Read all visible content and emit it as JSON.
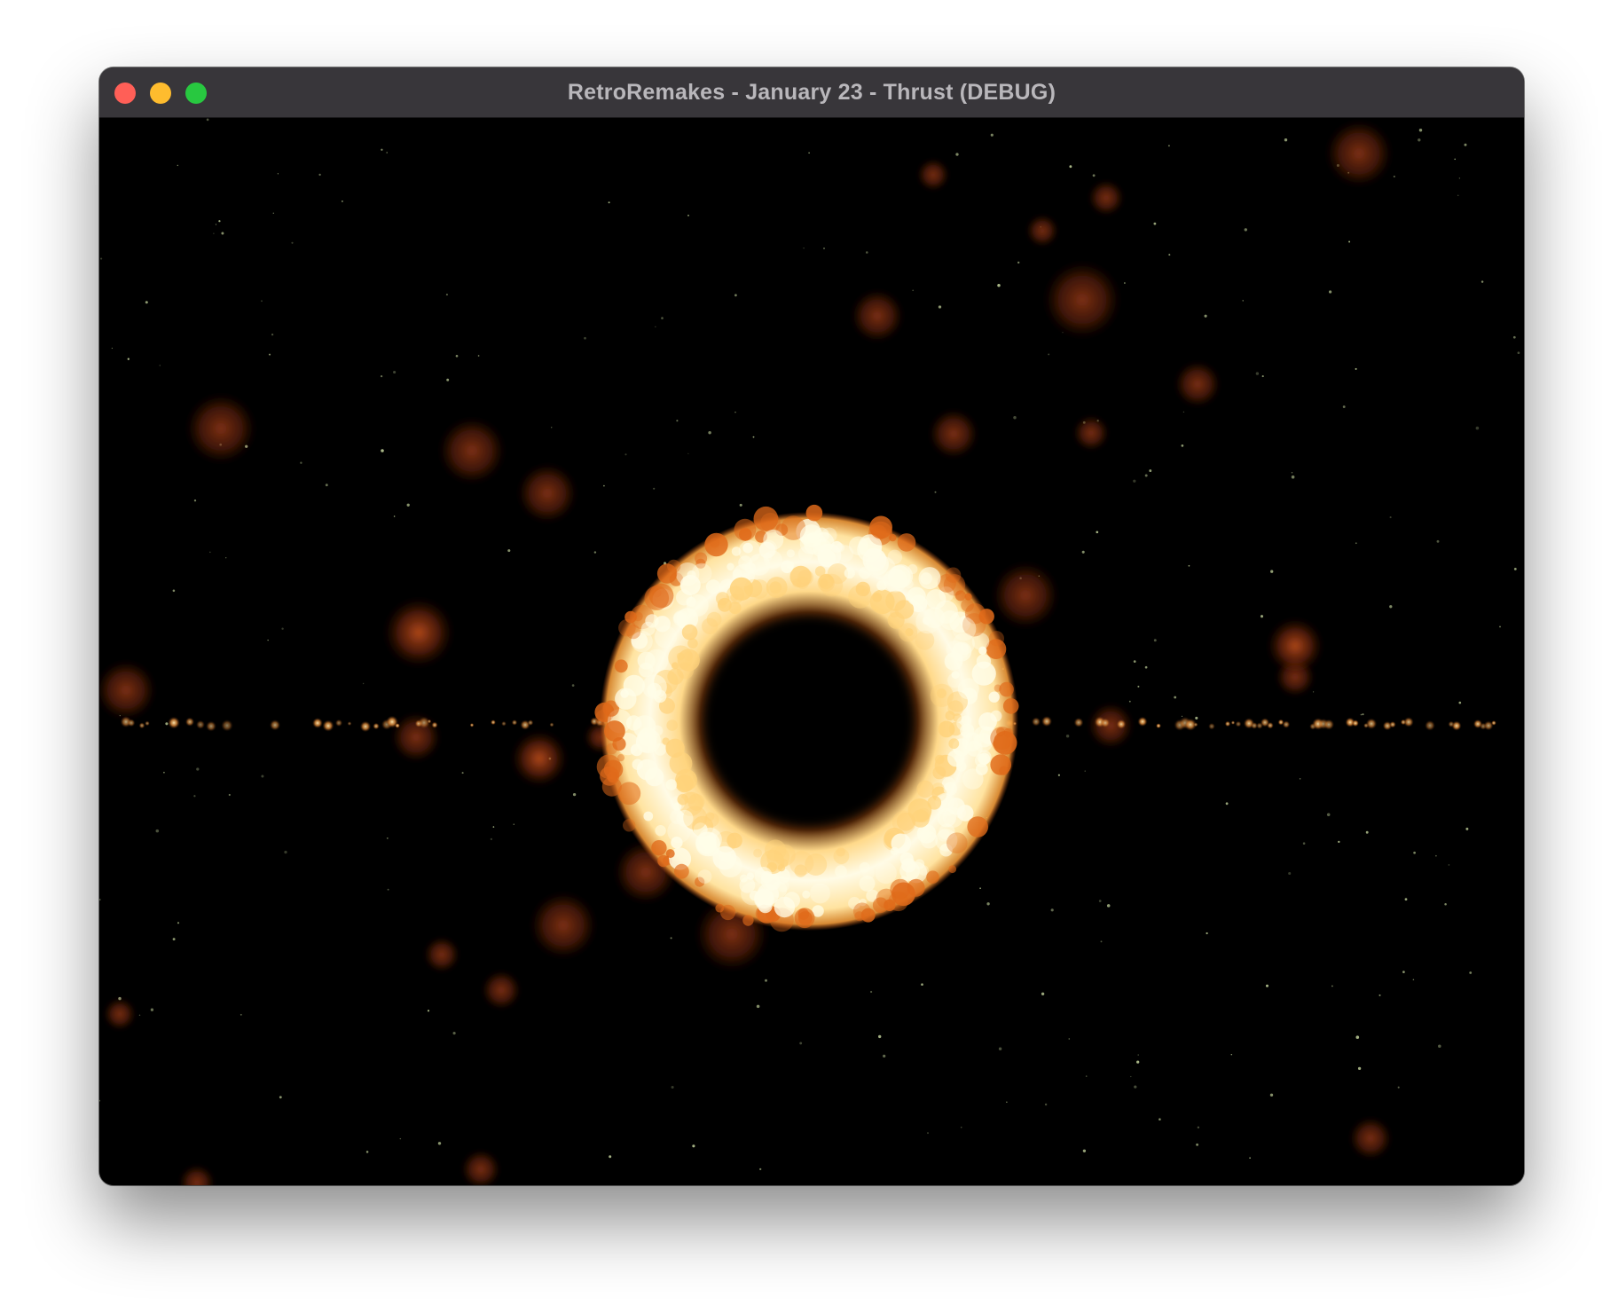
{
  "window": {
    "title": "RetroRemakes - January 23 - Thrust (DEBUG)",
    "controls": {
      "close_color": "#ff5f57",
      "minimize_color": "#febc2e",
      "zoom_color": "#28c840"
    }
  },
  "scene": {
    "background": "#000000",
    "elements": [
      "starfield",
      "explosion-ring",
      "debris-line",
      "smoke-particles"
    ],
    "palette": {
      "ring_core": "#fffde8",
      "ring_mid": "#ffd27a",
      "ring_edge": "#e06a1a",
      "smoke": "#8a2e10",
      "star": "#c8d8a0"
    }
  }
}
